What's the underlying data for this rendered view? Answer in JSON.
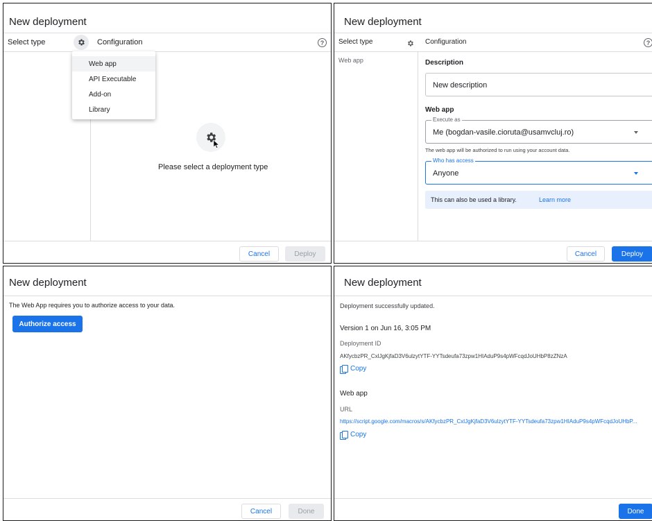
{
  "panels": {
    "p1": {
      "title": "New deployment",
      "select_type": "Select type",
      "configuration": "Configuration",
      "help": "?",
      "menu": [
        "Web app",
        "API Executable",
        "Add-on",
        "Library"
      ],
      "placeholder_message": "Please select a deployment type",
      "cancel": "Cancel",
      "deploy": "Deploy"
    },
    "p2": {
      "title": "New deployment",
      "select_type": "Select type",
      "configuration": "Configuration",
      "help": "?",
      "type_item": "Web app",
      "description_label": "Description",
      "description_placeholder": "New description",
      "webapp_label": "Web app",
      "execute_as_legend": "Execute as",
      "execute_as_value": "Me (bogdan-vasile.cioruta@usamvcluj.ro)",
      "execute_as_helper": "The web app will be authorized to run using your account data.",
      "who_access_legend": "Who has access",
      "who_access_value": "Anyone",
      "library_note": "This can also be used a library.",
      "learn_more": "Learn more",
      "cancel": "Cancel",
      "deploy": "Deploy"
    },
    "p3": {
      "title": "New deployment",
      "message": "The Web App requires you to authorize access to your data.",
      "authorize": "Authorize access",
      "cancel": "Cancel",
      "done": "Done"
    },
    "p4": {
      "title": "New deployment",
      "status": "Deployment successfully updated.",
      "version": "Version 1 on Jun 16, 3:05 PM",
      "deployment_id_label": "Deployment ID",
      "deployment_id": "AKfycbzPR_CxlJgKjfaD3V6ulzytYTF-YYTsdeufa73zpw1HIAduP9s4pWFcqdJoUHbP8zZNzA",
      "copy": "Copy",
      "webapp_label": "Web app",
      "url_label": "URL",
      "url": "https://script.google.com/macros/s/AKfycbzPR_CxlJgKjfaD3V6ulzytYTF-YYTsdeufa73zpw1HIAduP9s4pWFcqdJoUHbP...",
      "copy2": "Copy",
      "done": "Done"
    }
  },
  "colors": {
    "accent": "#1a73e8",
    "divider": "#dadce0",
    "info_bg": "#e8f0fe"
  },
  "icons": [
    "gear-icon",
    "help-icon",
    "chevron-down-icon",
    "copy-icon",
    "cursor-icon"
  ]
}
